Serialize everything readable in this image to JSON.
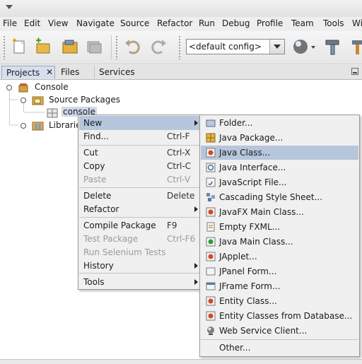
{
  "menubar": {
    "items": [
      {
        "label": "File"
      },
      {
        "label": "Edit"
      },
      {
        "label": "View"
      },
      {
        "label": "Navigate"
      },
      {
        "label": "Source"
      },
      {
        "label": "Refactor"
      },
      {
        "label": "Run"
      },
      {
        "label": "Debug"
      },
      {
        "label": "Profile"
      },
      {
        "label": "Team"
      },
      {
        "label": "Tools"
      },
      {
        "label": "Wi"
      }
    ]
  },
  "toolbar": {
    "config_value": "<default config>",
    "icons": [
      "new-file-icon",
      "new-project-icon",
      "open-project-icon",
      "close-project-icon",
      "undo-icon",
      "redo-icon",
      "globe-icon",
      "hammer-icon",
      "clean-build-icon"
    ]
  },
  "tabs": [
    {
      "label": "Projects"
    },
    {
      "label": "Files"
    },
    {
      "label": "Services"
    }
  ],
  "tab_close_glyph": "✕",
  "tree": {
    "root": "Console",
    "source_packages": "Source Packages",
    "package": "console",
    "libraries": "Librarie"
  },
  "context_menu": {
    "items": [
      {
        "label": "New"
      },
      {
        "label": "Find...",
        "shortcut": "Ctrl-F"
      },
      {
        "label": "Cut",
        "shortcut": "Ctrl-X"
      },
      {
        "label": "Copy",
        "shortcut": "Ctrl-C"
      },
      {
        "label": "Paste",
        "shortcut": "Ctrl-V"
      },
      {
        "label": "Delete",
        "shortcut": "Delete"
      },
      {
        "label": "Refactor"
      },
      {
        "label": "Compile Package",
        "shortcut": "F9"
      },
      {
        "label": "Test Package",
        "shortcut": "Ctrl-F6"
      },
      {
        "label": "Run Selenium Tests"
      },
      {
        "label": "History"
      },
      {
        "label": "Tools"
      }
    ]
  },
  "submenu": {
    "items": [
      {
        "label": "Folder..."
      },
      {
        "label": "Java Package..."
      },
      {
        "label": "Java Class..."
      },
      {
        "label": "Java Interface..."
      },
      {
        "label": "JavaScript File..."
      },
      {
        "label": "Cascading Style Sheet..."
      },
      {
        "label": "JavaFX Main Class..."
      },
      {
        "label": "Empty FXML..."
      },
      {
        "label": "Java Main Class..."
      },
      {
        "label": "JApplet..."
      },
      {
        "label": "JPanel Form..."
      },
      {
        "label": "JFrame Form..."
      },
      {
        "label": "Entity Class..."
      },
      {
        "label": "Entity Classes from Database..."
      },
      {
        "label": "Web Service Client..."
      },
      {
        "label": "Other..."
      }
    ]
  },
  "colors": {
    "highlight": "#b6c6dc",
    "selection": "#cfd9ea",
    "disabled_text": "#9a9a9a"
  }
}
